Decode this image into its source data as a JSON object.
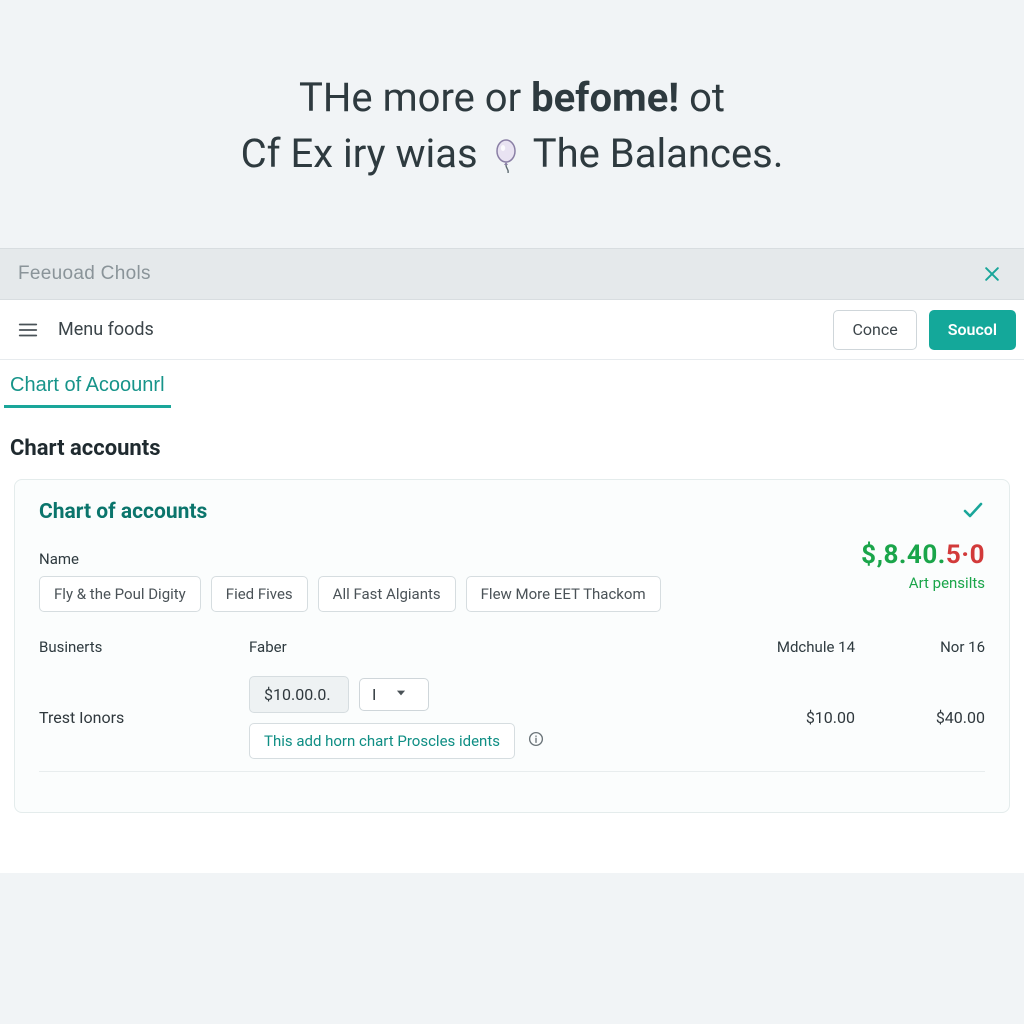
{
  "hero": {
    "line1_pre": "THe more or ",
    "line1_bold": "befome!",
    "line1_post": "  ot",
    "line2_pre": "Cf Ex iry wias ",
    "line2_post": " The Balances."
  },
  "greybar": {
    "title": "Feeuoad Chols"
  },
  "toolbar": {
    "label": "Menu foods",
    "cancel_label": "Conce",
    "submit_label": "Soucol"
  },
  "tabs": {
    "active": "Chart of Acoounrl"
  },
  "section_heading": "Chart accounts",
  "card": {
    "title": "Chart of accounts",
    "name_label": "Name",
    "chips": [
      "Fly & the Poul Digity",
      "Fied Fives",
      "All Fast Algiants",
      "Flew More EET Thackom"
    ],
    "amount_green": "$,8.40.",
    "amount_red": "5·0",
    "amount_sub": "Art pensilts",
    "columns": {
      "c0": "Businerts",
      "c1": "Faber",
      "c2": "Mdchule 14",
      "c3": "Nor 16"
    },
    "row": {
      "name": "Trest Ionors",
      "faber_value": "$10.00.0.",
      "select_value": "I",
      "col2": "$10.00",
      "col3": "$40.00",
      "hint": "This add horn chart Proscles idents"
    }
  }
}
